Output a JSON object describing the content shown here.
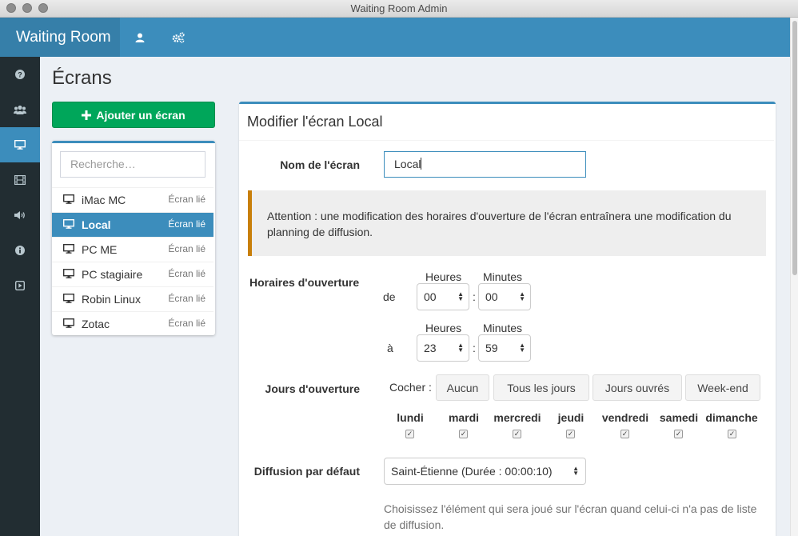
{
  "window": {
    "title": "Waiting Room Admin"
  },
  "navbar": {
    "brand": "Waiting Room",
    "icons": [
      "user-icon",
      "cogs-icon"
    ]
  },
  "sidebar": {
    "items": [
      {
        "icon": "question-icon"
      },
      {
        "icon": "users-icon"
      },
      {
        "icon": "desktop-icon",
        "active": true
      },
      {
        "icon": "film-icon"
      },
      {
        "icon": "volume-icon"
      },
      {
        "icon": "info-icon"
      },
      {
        "icon": "play-icon"
      }
    ]
  },
  "page": {
    "title": "Écrans"
  },
  "screens": {
    "add_label": "Ajouter un écran",
    "search_placeholder": "Recherche…",
    "items": [
      {
        "name": "iMac MC",
        "status": "Écran lié"
      },
      {
        "name": "Local",
        "status": "Écran lié",
        "active": true
      },
      {
        "name": "PC ME",
        "status": "Écran lié"
      },
      {
        "name": "PC stagiaire",
        "status": "Écran lié"
      },
      {
        "name": "Robin Linux",
        "status": "Écran lié"
      },
      {
        "name": "Zotac",
        "status": "Écran lié"
      }
    ]
  },
  "form": {
    "header": "Modifier l'écran Local",
    "name_label": "Nom de l'écran",
    "name_value": "Local",
    "warning": "Attention : une modification des horaires d'ouverture de l'écran entraînera une modification du planning de diffusion.",
    "hours_label": "Horaires d'ouverture",
    "from_label": "de",
    "to_label": "à",
    "hours_col": "Heures",
    "minutes_col": "Minutes",
    "from_hour": "00",
    "from_minute": "00",
    "to_hour": "23",
    "to_minute": "59",
    "days_label": "Jours d'ouverture",
    "check_label": "Cocher :",
    "buttons": {
      "none": "Aucun",
      "all": "Tous les jours",
      "workdays": "Jours ouvrés",
      "weekend": "Week-end"
    },
    "days": [
      {
        "name": "lundi",
        "checked": true
      },
      {
        "name": "mardi",
        "checked": true
      },
      {
        "name": "mercredi",
        "checked": true
      },
      {
        "name": "jeudi",
        "checked": true
      },
      {
        "name": "vendredi",
        "checked": true
      },
      {
        "name": "samedi",
        "checked": true
      },
      {
        "name": "dimanche",
        "checked": true
      }
    ],
    "default_label": "Diffusion par défaut",
    "default_value": "Saint-Étienne (Durée : 00:00:10)",
    "default_help": "Choisissez l'élément qui sera joué sur l'écran quand celui-ci n'a pas de liste de diffusion."
  },
  "colors": {
    "primary": "#3c8dbc",
    "success": "#00a65a",
    "sidebar": "#222d32",
    "warning": "#c87f0a"
  }
}
